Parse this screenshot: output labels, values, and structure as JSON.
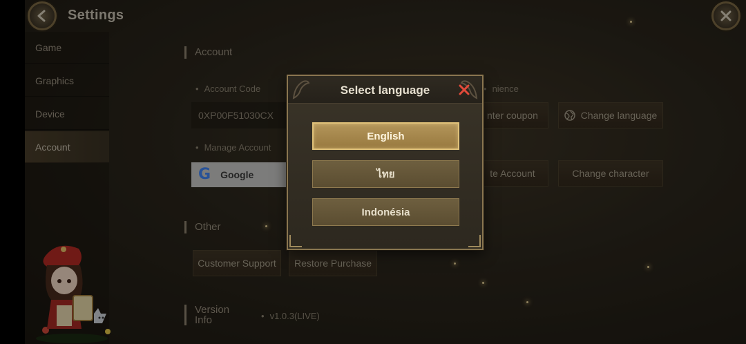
{
  "header": {
    "title": "Settings"
  },
  "sidebar": {
    "items": [
      {
        "label": "Game"
      },
      {
        "label": "Graphics"
      },
      {
        "label": "Device"
      },
      {
        "label": "Account"
      }
    ]
  },
  "account": {
    "section_title": "Account",
    "account_code_label": "Account Code",
    "account_code_value": "0XP00F51030CX",
    "convenience_label": "nience",
    "enter_coupon_label": "nter coupon",
    "change_language_label": "Change language",
    "manage_account_label": "Manage Account",
    "google_label": "Google",
    "te_account_label": "te Account",
    "change_character_label": "Change character"
  },
  "other": {
    "section_title": "Other",
    "customer_support_label": "Customer Support",
    "restore_purchase_label": "Restore Purchase"
  },
  "version": {
    "title_line1": "Version",
    "title_line2": "Info",
    "value": "v1.0.3(LIVE)"
  },
  "modal": {
    "title": "Select language",
    "languages": [
      {
        "label": "English",
        "selected": true
      },
      {
        "label": "ไทย",
        "selected": false
      },
      {
        "label": "Indonésia",
        "selected": false
      }
    ]
  },
  "colors": {
    "accent_gold": "#e0c27a",
    "close_red": "#e24a3a",
    "background": "#2b261c"
  }
}
